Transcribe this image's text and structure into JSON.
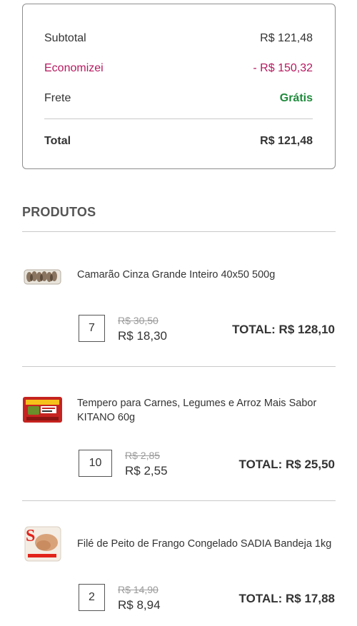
{
  "summary": {
    "subtotal_label": "Subtotal",
    "subtotal_value": "R$ 121,48",
    "savings_label": "Economizei",
    "savings_value": "- R$ 150,32",
    "shipping_label": "Frete",
    "shipping_value": "Grátis",
    "total_label": "Total",
    "total_value": "R$ 121,48"
  },
  "products_title": "PRODUTOS",
  "products": [
    {
      "name": "Camarão Cinza Grande Inteiro 40x50 500g",
      "quantity": "7",
      "old_price": "R$ 30,50",
      "price": "R$ 18,30",
      "total": "TOTAL: R$ 128,10",
      "icon": "shrimp-package-icon"
    },
    {
      "name": "Tempero para Carnes, Legumes e Arroz Mais Sabor KITANO 60g",
      "quantity": "10",
      "old_price": "R$ 2,85",
      "price": "R$ 2,55",
      "total": "TOTAL: R$ 25,50",
      "icon": "seasoning-package-icon"
    },
    {
      "name": "Filé de Peito de Frango Congelado SADIA Bandeja 1kg",
      "quantity": "2",
      "old_price": "R$ 14,90",
      "price": "R$ 8,94",
      "total": "TOTAL: R$ 17,88",
      "icon": "chicken-package-icon"
    }
  ],
  "colors": {
    "savings": "#b5195f",
    "free_shipping": "#1f8a3c",
    "divider": "#c9c9c9"
  }
}
